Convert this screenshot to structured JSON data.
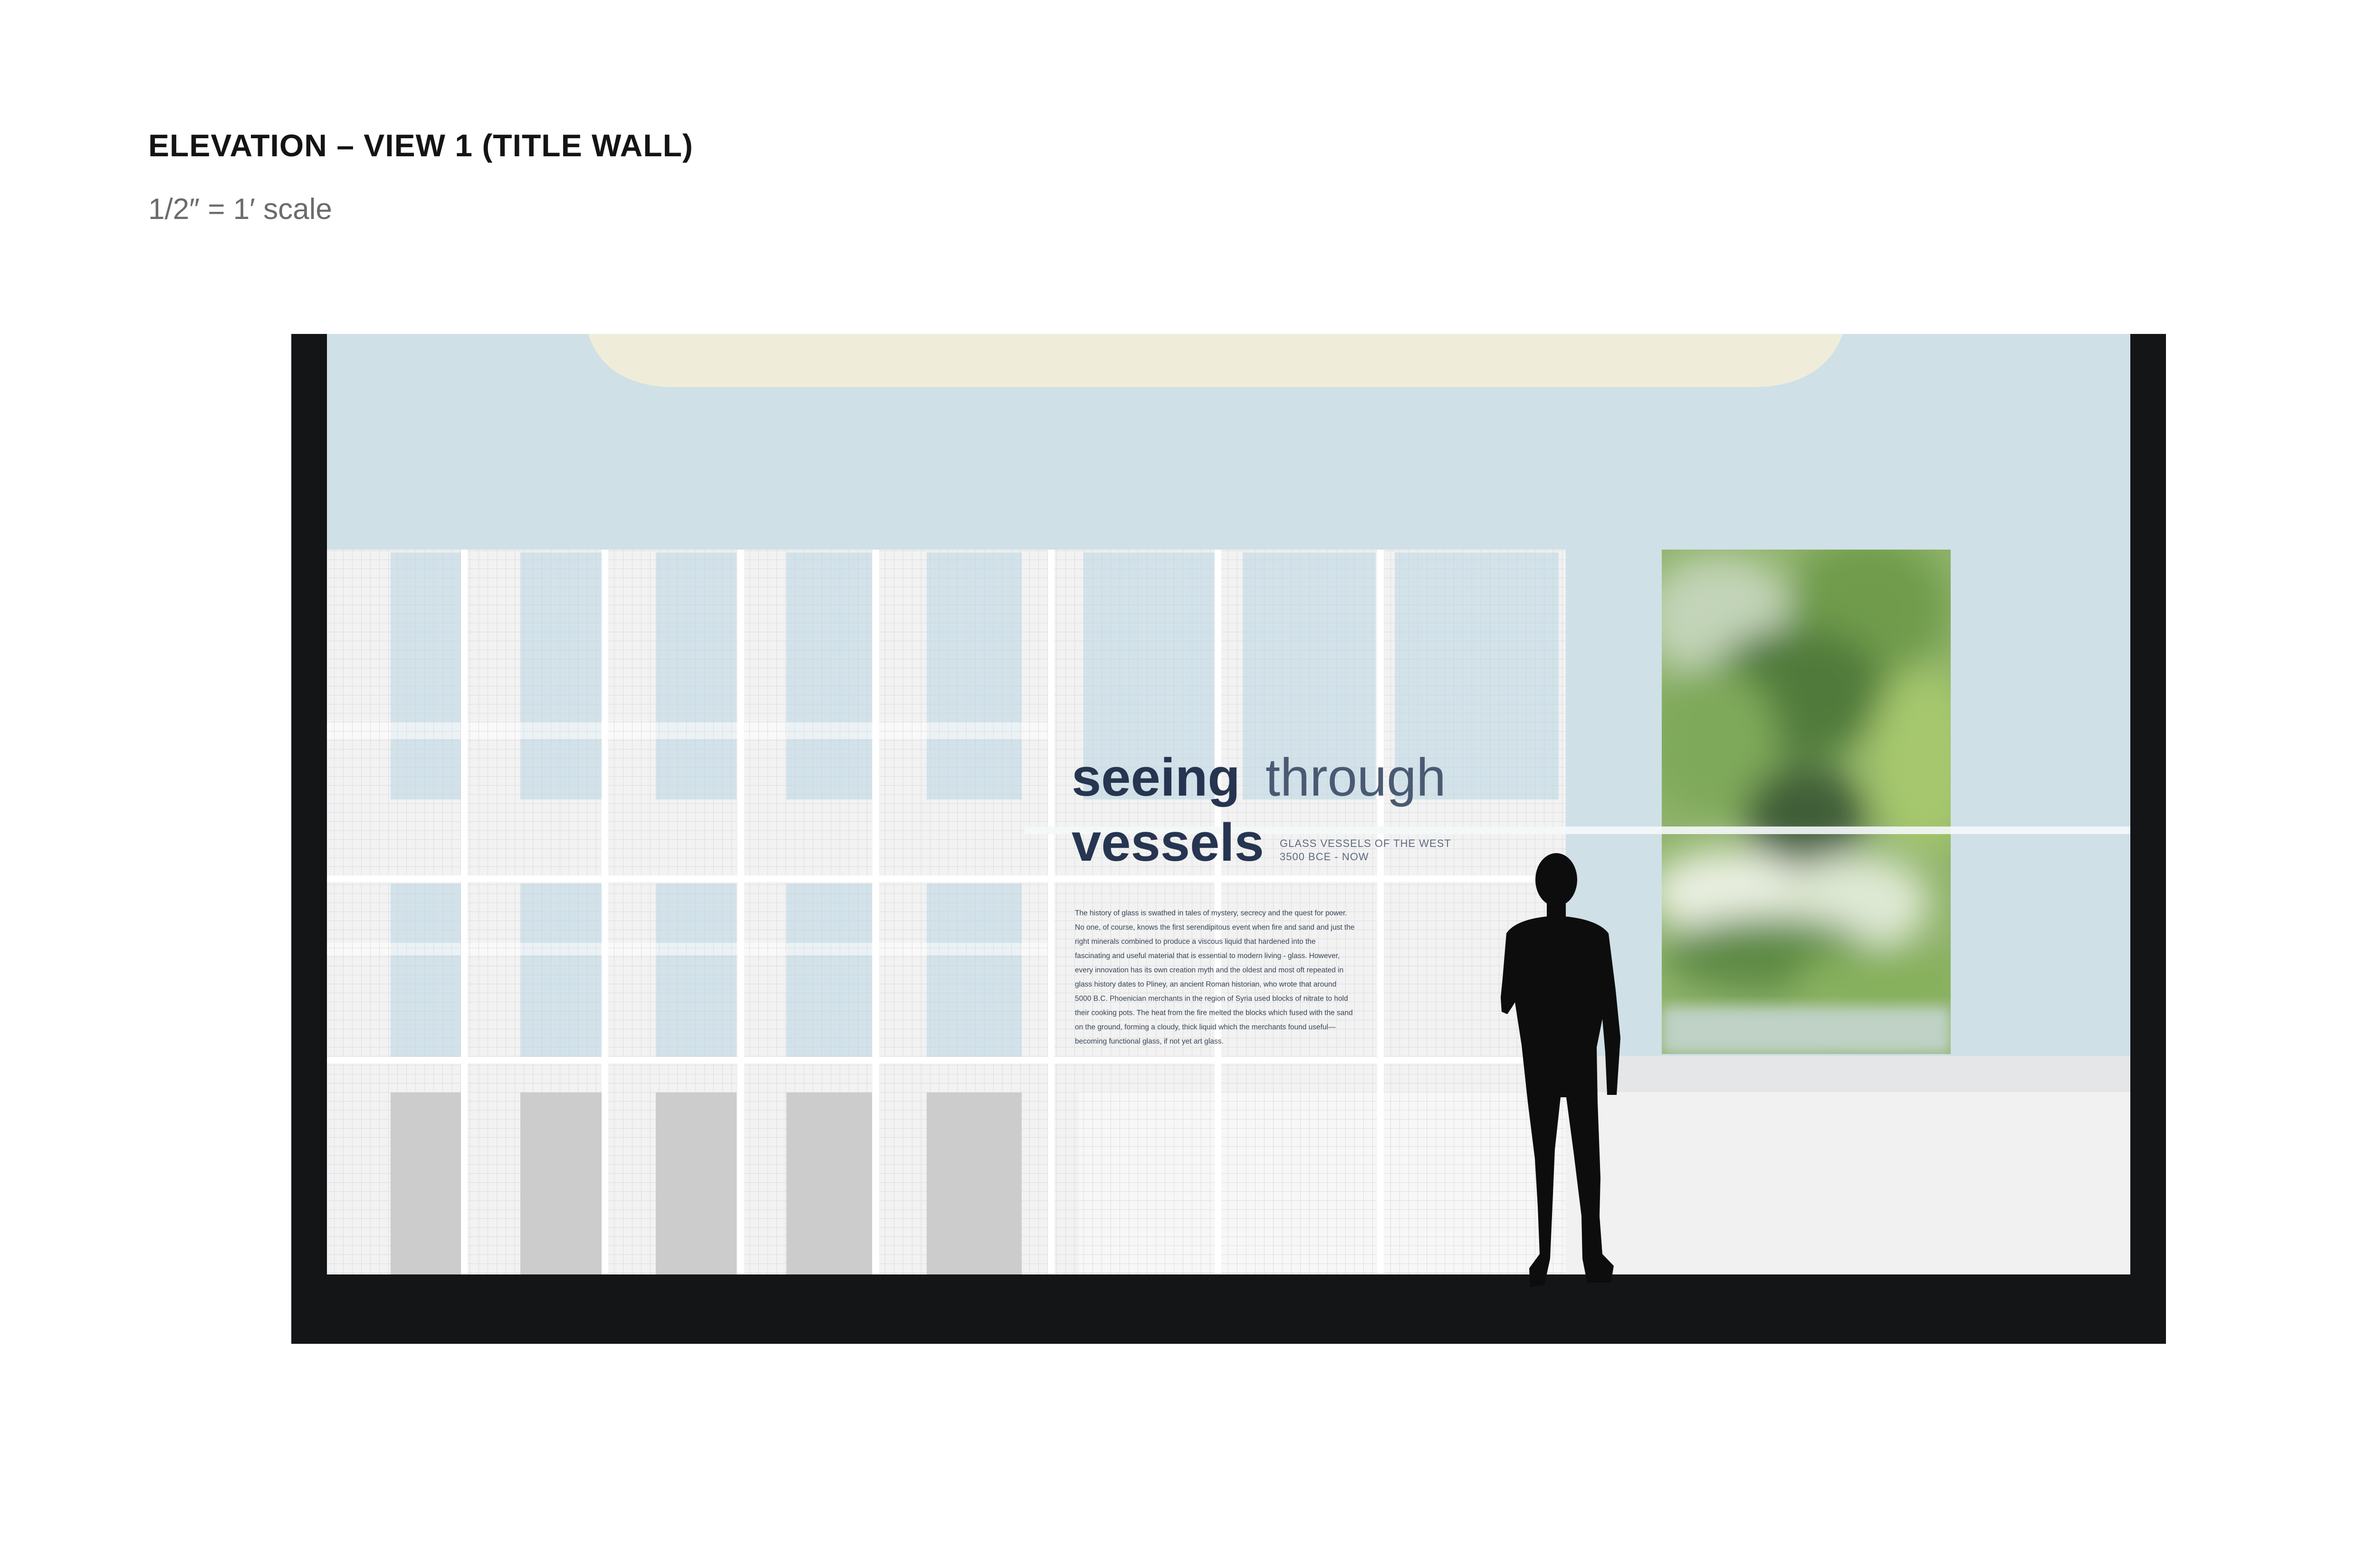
{
  "sheet": {
    "title": "ELEVATION – VIEW 1 (TITLE WALL)",
    "scale": "1/2″ = 1′ scale"
  },
  "title_wall": {
    "headline_line1_bold": "seeing",
    "headline_line1_light": "through",
    "headline_line2_bold": "vessels",
    "subtitle_line1": "GLASS VESSELS OF THE WEST",
    "subtitle_line2": "3500 BCE - NOW",
    "body_lines": [
      "The history of glass is swathed in tales of mystery, secrecy and the quest for power.",
      "No one, of course, knows the first serendipitous event when fire and sand and just the",
      "right minerals combined to produce a viscous liquid that hardened into the",
      "fascinating and useful material that is essential to modern living - glass. However,",
      "every innovation has its own creation myth and the oldest and most oft repeated in",
      "glass history dates to Pliney, an ancient Roman historian, who wrote that around",
      "5000 B.C. Phoenician merchants in the region of Syria used blocks of nitrate to hold",
      "their cooking pots. The heat from the fire melted the blocks which fused with the sand",
      "on the ground, forming a cloudy, thick liquid which the merchants found useful—",
      "becoming functional glass, if not yet art glass."
    ]
  },
  "colors": {
    "frame": "#141516",
    "wall": "#cfe0e7",
    "ceiling_cove": "#efedda",
    "panel_white": "#f2f2f2",
    "headline_ink": "#263550",
    "plant_green": "#7aa353",
    "silhouette": "#0d0d0d"
  },
  "icons": {
    "human_figure": "person-silhouette-icon",
    "plant_photo": "plant-photo-panel"
  }
}
